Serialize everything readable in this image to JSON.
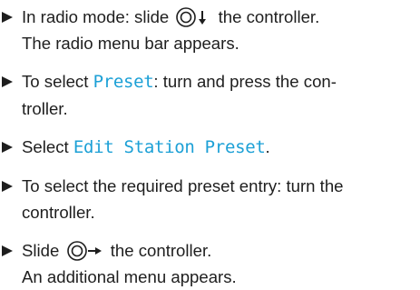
{
  "steps": [
    {
      "prefix": "In radio mode: slide",
      "suffix": "the controller.",
      "result": "The radio menu bar appears."
    },
    {
      "prefix": "To select",
      "menu": "Preset",
      "suffix_line1": ": turn and press the con-",
      "suffix_line2": "troller."
    },
    {
      "prefix": "Select",
      "menu": "Edit Station Preset",
      "suffix": "."
    },
    {
      "line1": "To select the required preset entry: turn the",
      "line2": "controller."
    },
    {
      "prefix": "Slide",
      "suffix": "the controller.",
      "result": "An additional menu appears."
    }
  ],
  "icons": {
    "controller_slide_down": "controller-slide-down-icon",
    "controller_slide_right": "controller-slide-right-icon"
  },
  "colors": {
    "text": "#1e1e1e",
    "menu_text": "#1ca0d6"
  }
}
